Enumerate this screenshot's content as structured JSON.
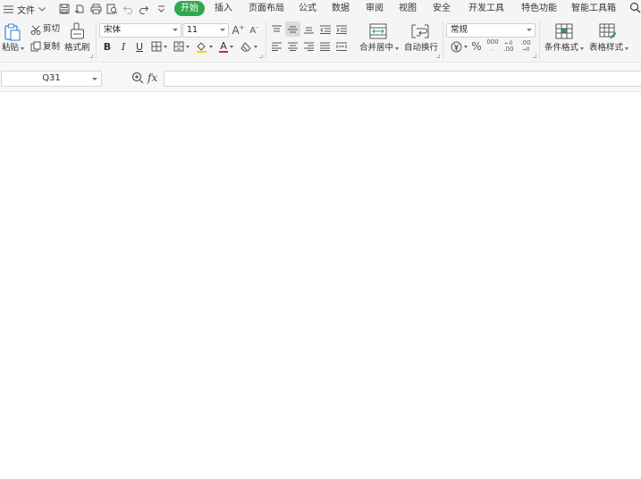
{
  "menu": {
    "file_label": "文件",
    "tabs": [
      "开始",
      "插入",
      "页面布局",
      "公式",
      "数据",
      "审阅",
      "视图",
      "安全",
      "开发工具",
      "特色功能",
      "智能工具箱"
    ]
  },
  "ribbon": {
    "paste_label": "粘贴",
    "cut_label": "剪切",
    "copy_label": "复制",
    "format_painter_label": "格式刷",
    "font_name": "宋体",
    "font_size": "11",
    "merge_center_label": "合并居中",
    "wrap_text_label": "自动换行",
    "number_format": "常规",
    "conditional_format_label": "条件格式",
    "table_style_label": "表格样式",
    "bold": "B",
    "italic": "I",
    "underline": "U",
    "font_color_glyph": "A",
    "increase_font_glyph": "A",
    "decrease_font_glyph": "A",
    "percent_glyph": "%",
    "thousands_glyph": "000",
    "inc_decimal_glyph": ".00",
    "dec_decimal_glyph": ".00"
  },
  "formula_bar": {
    "cell_ref": "Q31",
    "fx_label": "fx",
    "formula_value": ""
  },
  "colors": {
    "active_tab": "#2fa84f",
    "font_color": "#e02020",
    "fill_color": "#f5d800"
  }
}
